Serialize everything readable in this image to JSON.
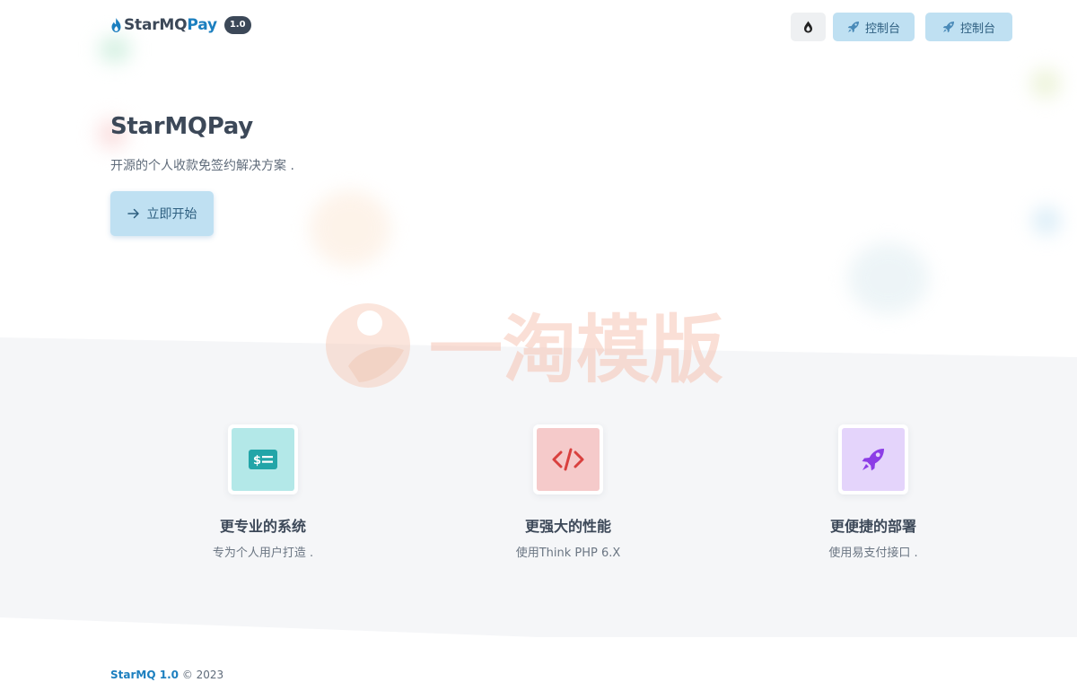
{
  "header": {
    "logo_main": "StarMQ",
    "logo_accent": "Pay",
    "version": "1.0",
    "theme_toggle_icon": "drop-icon",
    "console_buttons": [
      {
        "label": "控制台",
        "icon": "rocket-icon"
      },
      {
        "label": "控制台",
        "icon": "rocket-icon"
      }
    ]
  },
  "hero": {
    "title": "StarMQPay",
    "subtitle": "开源的个人收款免签约解决方案 .",
    "start_button": "立即开始",
    "start_icon": "arrow-right-icon"
  },
  "watermark": {
    "text": "一淘模版"
  },
  "features": [
    {
      "title": "更专业的系统",
      "desc": "专为个人用户打造 .",
      "icon": "money-icon",
      "color": "#b3e8e8"
    },
    {
      "title": "更强大的性能",
      "desc": "使用Think PHP 6.X",
      "icon": "code-icon",
      "color": "#f5caca"
    },
    {
      "title": "更便捷的部署",
      "desc": "使用易支付接口 .",
      "icon": "rocket-icon",
      "color": "#e4d4fb"
    }
  ],
  "footer": {
    "brand": "StarMQ 1.0",
    "copyright": "© 2023"
  },
  "colors": {
    "accent": "#1c7fbf",
    "button_bg": "#bfe0f2",
    "section_bg": "#f5f6f8"
  }
}
